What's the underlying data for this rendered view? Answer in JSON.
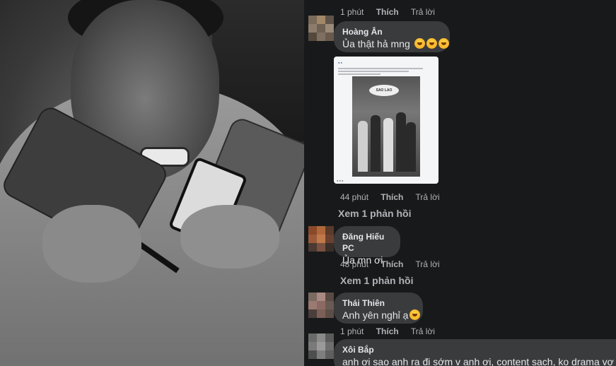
{
  "comments": [
    {
      "id": "c0",
      "name": "",
      "text": "",
      "time": "1 phút",
      "like_label": "Thích",
      "reply_label": "Trả lời"
    },
    {
      "id": "c1",
      "name": "Hoàng Ân",
      "text": "Ủa thật hả mng",
      "emojis": [
        "crying-face",
        "crying-face",
        "crying-face"
      ],
      "time": "44 phút",
      "like_label": "Thích",
      "reply_label": "Trả lời",
      "view_replies": "Xem 1 phản hồi",
      "attachment": {
        "type": "screenshot of facebook post",
        "sign_text": "SAO LAO"
      }
    },
    {
      "id": "c2",
      "name": "Đăng Hiếu PC",
      "text": "Ủa mn ơi",
      "time": "48 phút",
      "like_label": "Thích",
      "reply_label": "Trả lời",
      "view_replies": "Xem 1 phản hồi"
    },
    {
      "id": "c3",
      "name": "Thái Thiên",
      "text": "Anh yên nghỉ ạ",
      "emojis": [
        "flushed-face"
      ],
      "time": "1 phút",
      "like_label": "Thích",
      "reply_label": "Trả lời"
    },
    {
      "id": "c4",
      "name": "Xôi Bắp",
      "text": "anh ơi sao anh ra đi sớm v anh ơi, content sạch, ko drama vợ đu"
    }
  ],
  "colors": {
    "panel_bg": "#18191a",
    "bubble_bg": "#3a3b3c",
    "text_primary": "#e4e6eb",
    "text_secondary": "#b0b3b8"
  }
}
